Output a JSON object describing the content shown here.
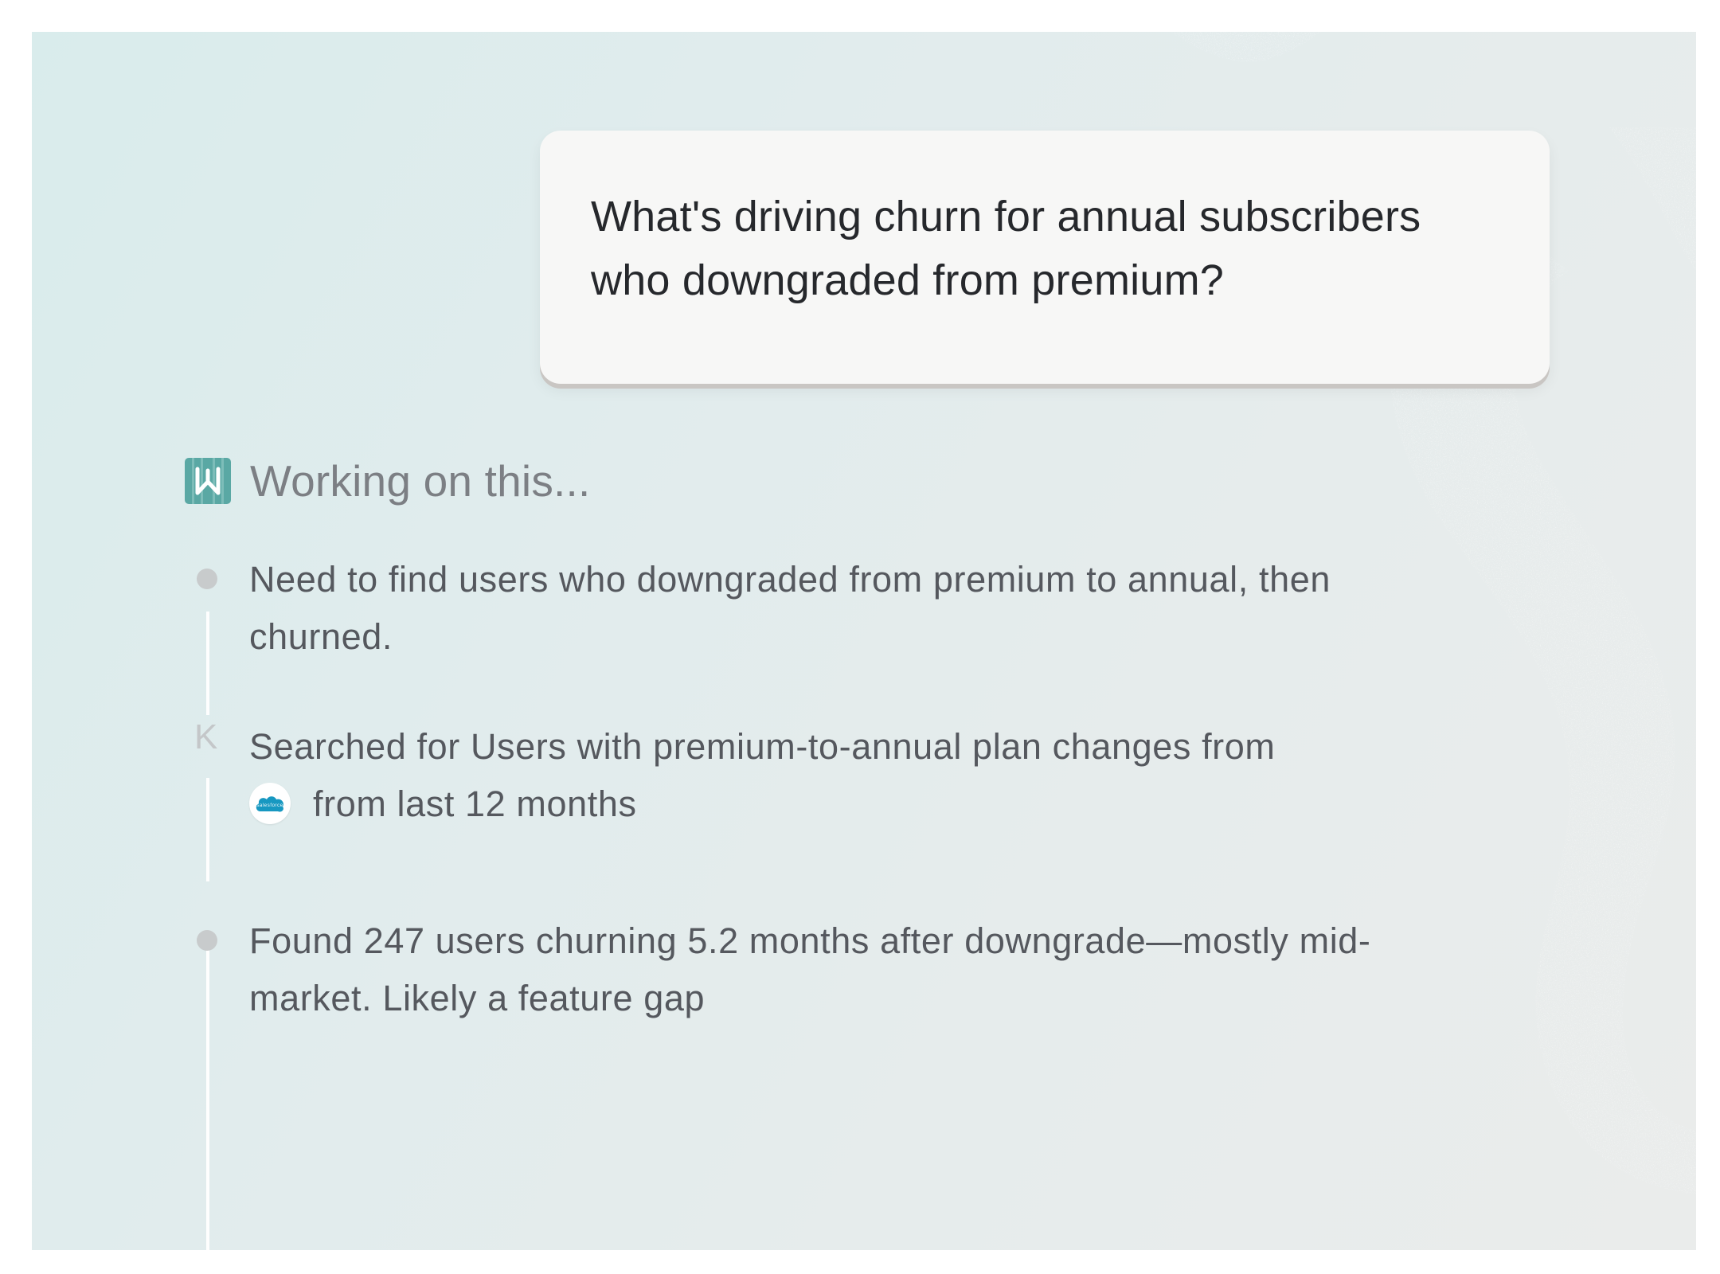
{
  "user_message": {
    "line1": "What's driving churn for annual subscribers",
    "line2": "who downgraded from premium?"
  },
  "status": {
    "icon": "logo-icon",
    "text": "Working on this..."
  },
  "steps": [
    {
      "icon": "dot",
      "line1": "Need to find users who downgraded from premium to annual, then",
      "line2": "churned."
    },
    {
      "icon": "k-icon",
      "icon_glyph": "K",
      "line1": "Searched for Users with premium-to-annual plan changes from",
      "source_icon": "salesforce-icon",
      "source_label": "salesforce",
      "line2": "from last 12 months"
    },
    {
      "icon": "dot",
      "line1": "Found 247 users churning 5.2 months after downgrade—mostly mid-",
      "line2": "market. Likely a feature gap"
    }
  ],
  "colors": {
    "accent": "#5aa8a4",
    "salesforce": "#1798c1"
  }
}
